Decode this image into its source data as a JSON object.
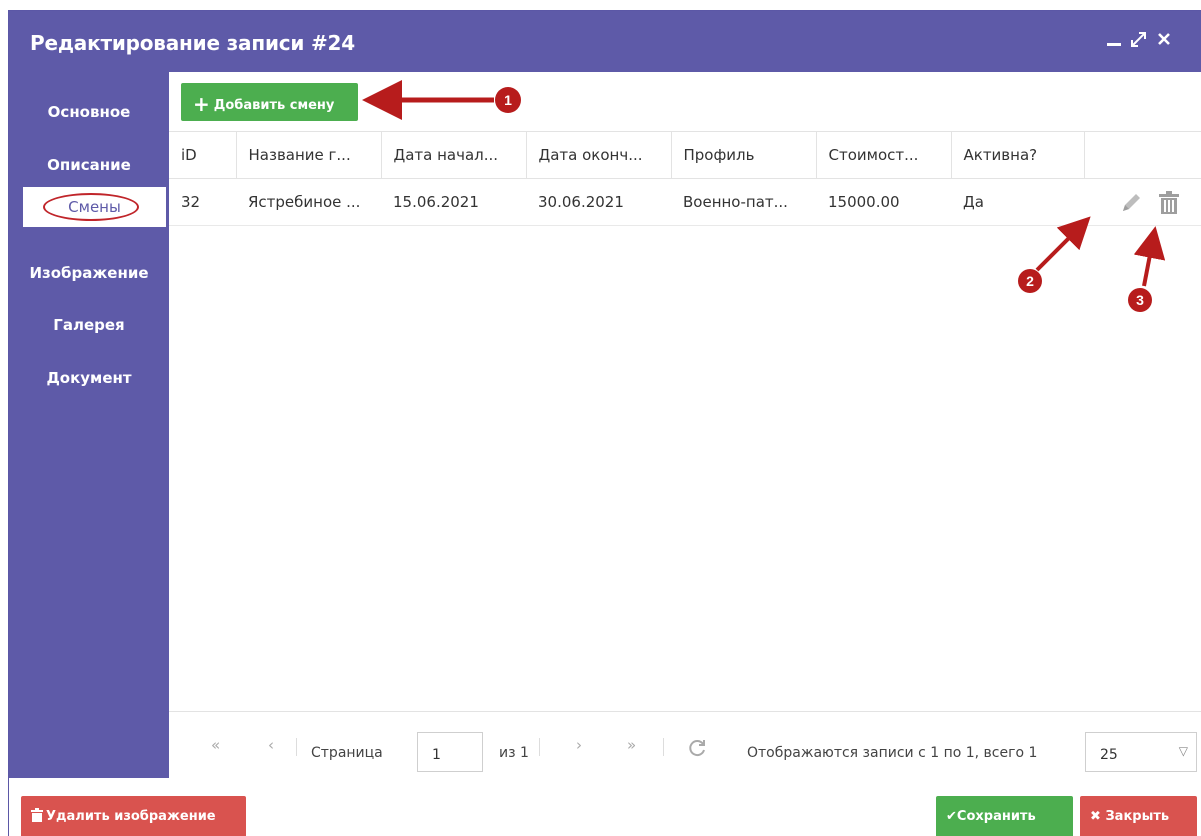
{
  "window": {
    "title": "Редактирование записи #24",
    "controls": [
      "minimize-icon",
      "maximize-icon",
      "close-icon"
    ]
  },
  "sidebar": {
    "items": [
      {
        "label": "Основное",
        "active": false
      },
      {
        "label": "Описание",
        "active": false
      },
      {
        "label": "Смены",
        "active": true
      },
      {
        "label": "Изображение",
        "active": false
      },
      {
        "label": "Галерея",
        "active": false
      },
      {
        "label": "Документ",
        "active": false
      }
    ]
  },
  "toolbar": {
    "add_label": "Добавить смену",
    "add_icon": "plus-icon"
  },
  "table": {
    "columns": [
      "iD",
      "Название г...",
      "Дата начал...",
      "Дата оконч...",
      "Профиль",
      "Стоимост...",
      "Активна?",
      ""
    ],
    "rows": [
      {
        "id": "32",
        "name": "Ястребиное ...",
        "start": "15.06.2021",
        "end": "30.06.2021",
        "profile": "Военно-пат...",
        "cost": "15000.00",
        "active": "Да",
        "actions": [
          "pencil-icon",
          "trash-icon"
        ]
      }
    ]
  },
  "pager": {
    "page_label": "Страница",
    "page_value": "1",
    "of_label": "из 1",
    "summary": "Отображаются записи с 1 по 1, всего 1",
    "per_page": "25"
  },
  "footer": {
    "delete_image_label": "Удалить изображение",
    "save_label": "Сохранить",
    "close_label": "Закрыть"
  },
  "annotations": [
    {
      "number": "1"
    },
    {
      "number": "2"
    },
    {
      "number": "3"
    }
  ],
  "colors": {
    "header": "#5e5aa8",
    "success": "#4cae4f",
    "danger": "#d9534f",
    "annotation": "#b71c1c"
  }
}
